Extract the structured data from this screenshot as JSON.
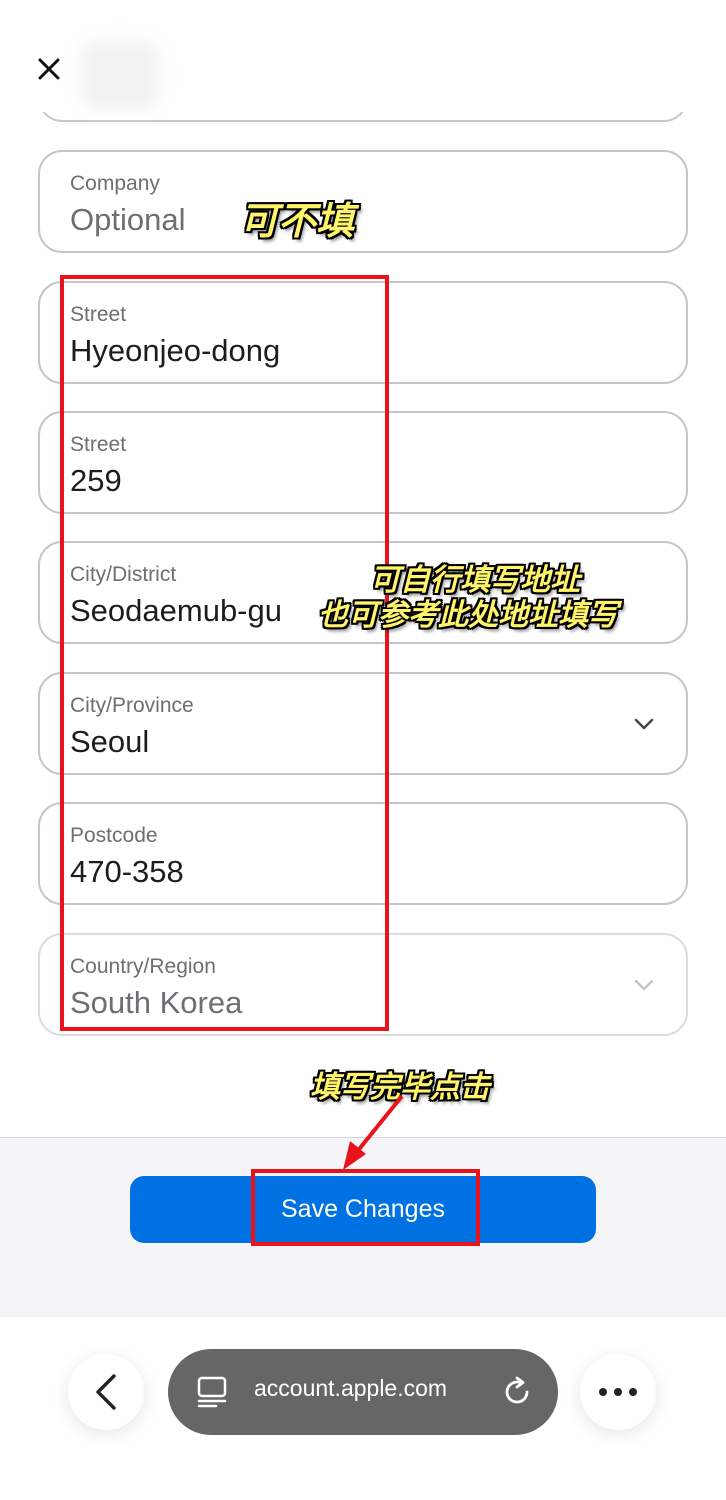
{
  "form": {
    "fields": [
      {
        "label": "Company",
        "value": "Optional",
        "placeholder": true
      },
      {
        "label": "Street",
        "value": "Hyeonjeo-dong"
      },
      {
        "label": "Street",
        "value": "259"
      },
      {
        "label": "City/District",
        "value": "Seodaemub-gu"
      },
      {
        "label": "City/Province",
        "value": "Seoul",
        "dropdown": true
      },
      {
        "label": "Postcode",
        "value": "470-358"
      },
      {
        "label": "Country/Region",
        "value": "South Korea",
        "dropdown": true,
        "disabled": true
      }
    ]
  },
  "annotations": {
    "optional_note": "可不填",
    "address_note_line1": "可自行填写地址",
    "address_note_line2": "也可参考此处地址填写",
    "click_note": "填写完毕点击"
  },
  "footer": {
    "save_label": "Save Changes"
  },
  "browser": {
    "url": "account.apple.com"
  },
  "colors": {
    "primary_button": "#0071e3",
    "annotation_red": "#e8131b",
    "annotation_text": "#fff46a",
    "url_pill": "#666666"
  }
}
